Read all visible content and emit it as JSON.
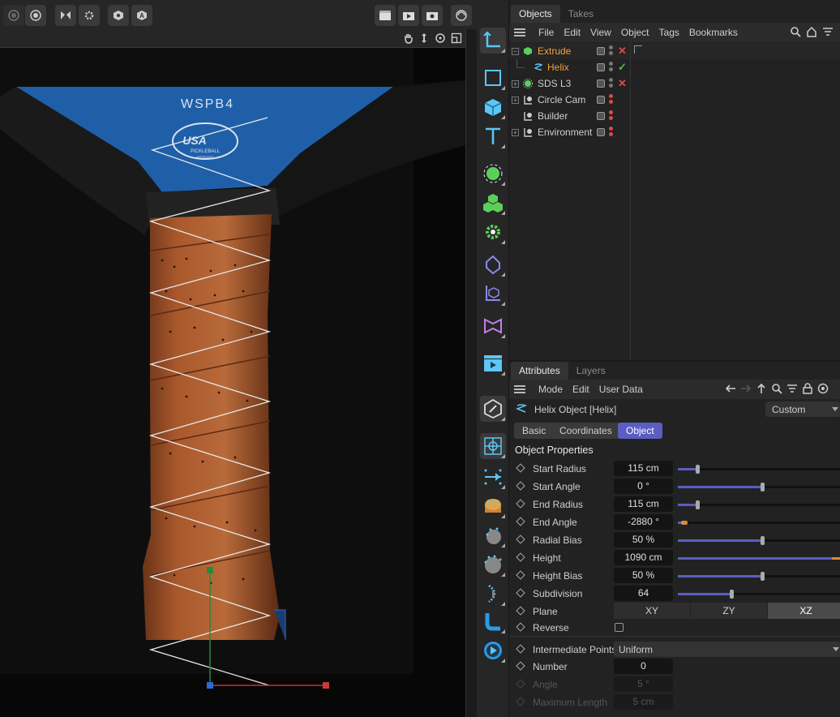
{
  "objects_panel": {
    "tabs": [
      "Objects",
      "Takes"
    ],
    "menu": [
      "File",
      "Edit",
      "View",
      "Object",
      "Tags",
      "Bookmarks"
    ],
    "items": [
      {
        "name": "Extrude",
        "color": "#f0a03c",
        "expand": "−",
        "mark": "✕",
        "mark_color": "#e04848"
      },
      {
        "name": "Helix",
        "color": "#f0a03c",
        "expand": "",
        "mark": "✓",
        "mark_color": "#49c24a"
      },
      {
        "name": "SDS L3",
        "color": "#cfcfcf",
        "expand": "+",
        "mark": "✕",
        "mark_color": "#e04848"
      },
      {
        "name": "Circle Cam",
        "color": "#cfcfcf",
        "expand": "+",
        "mark": "",
        "mark_color": ""
      },
      {
        "name": "Builder",
        "color": "#cfcfcf",
        "expand": "",
        "mark": "",
        "mark_color": ""
      },
      {
        "name": "Environment",
        "color": "#cfcfcf",
        "expand": "+",
        "mark": "",
        "mark_color": ""
      }
    ]
  },
  "attributes_panel": {
    "tabs": [
      "Attributes",
      "Layers"
    ],
    "menu": [
      "Mode",
      "Edit",
      "User Data"
    ],
    "object_title": "Helix Object [Helix]",
    "preset": "Custom",
    "subtabs": [
      "Basic",
      "Coordinates",
      "Object"
    ],
    "section_title": "Object Properties",
    "properties": [
      {
        "label": "Start Radius",
        "value": "115 cm",
        "slider": 0.12
      },
      {
        "label": "Start Angle",
        "value": "0 °",
        "slider": 0.52
      },
      {
        "label": "End Radius",
        "value": "115 cm",
        "slider": 0.12
      },
      {
        "label": "End Angle",
        "value": "-2880 °",
        "slider": 0.03
      },
      {
        "label": "Radial Bias",
        "value": "50 %",
        "slider": 0.52
      },
      {
        "label": "Height",
        "value": "1090 cm",
        "slider": 1.0
      },
      {
        "label": "Height Bias",
        "value": "50 %",
        "slider": 0.52
      },
      {
        "label": "Subdivision",
        "value": "64",
        "slider": 0.33
      }
    ],
    "plane": {
      "label": "Plane",
      "options": [
        "XY",
        "ZY",
        "XZ"
      ],
      "selected": "XZ"
    },
    "reverse": {
      "label": "Reverse"
    },
    "intermediate": {
      "label": "Intermediate Points",
      "value": "Uniform"
    },
    "number": {
      "label": "Number",
      "value": "0"
    },
    "angle": {
      "label": "Angle",
      "value": "5 °"
    },
    "max_length": {
      "label": "Maximum Length",
      "value": "5 cm"
    }
  },
  "viewport": {
    "paddle_text": "WSPB4",
    "logo_text": "USA",
    "logo_sub": "PICKLEBALL",
    "logo_sub2": "APPROVED"
  }
}
